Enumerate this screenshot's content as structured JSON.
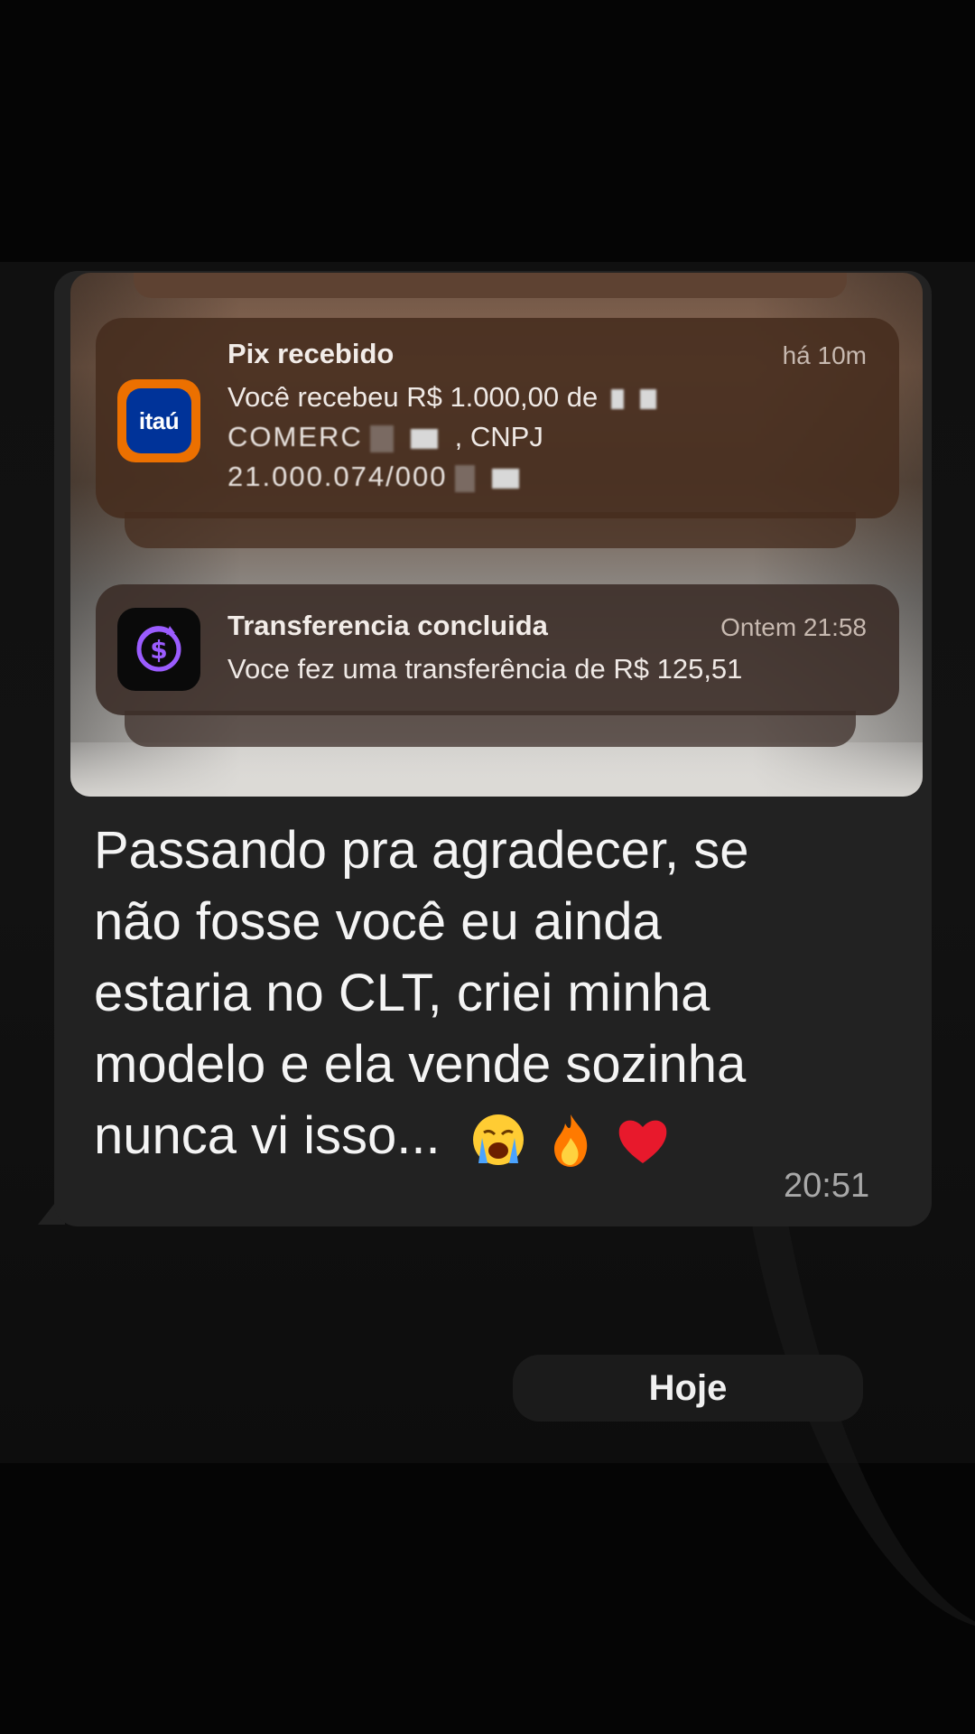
{
  "message": {
    "lines": [
      "Passando pra agradecer, se",
      "não fosse você eu ainda",
      "estaria no CLT, criei minha",
      "modelo e ela vende sozinha",
      "nunca vi isso..."
    ],
    "time": "20:51",
    "emojis": [
      "crying-face",
      "fire",
      "red-heart"
    ]
  },
  "notifications": [
    {
      "app_icon": "itau-icon",
      "app_icon_text": "itaú",
      "title": "Pix recebido",
      "time": "há 10m",
      "body_line1": "Você recebeu R$ 1.000,00 de",
      "body_line2_visible": ", CNPJ",
      "body_line2_garbled": "COMERC",
      "body_line3_garbled": "21.000.074/000"
    },
    {
      "app_icon": "dollar-transfer-icon",
      "title": "Transferencia concluida",
      "time": "Ontem 21:58",
      "body": "Voce fez uma transferência de R$ 125,51"
    }
  ],
  "date_separator": "Hoje",
  "colors": {
    "bubble": "#222222",
    "itau_orange": "#ec7000",
    "itau_blue": "#003399",
    "wallet_purple": "#9b5cff"
  }
}
